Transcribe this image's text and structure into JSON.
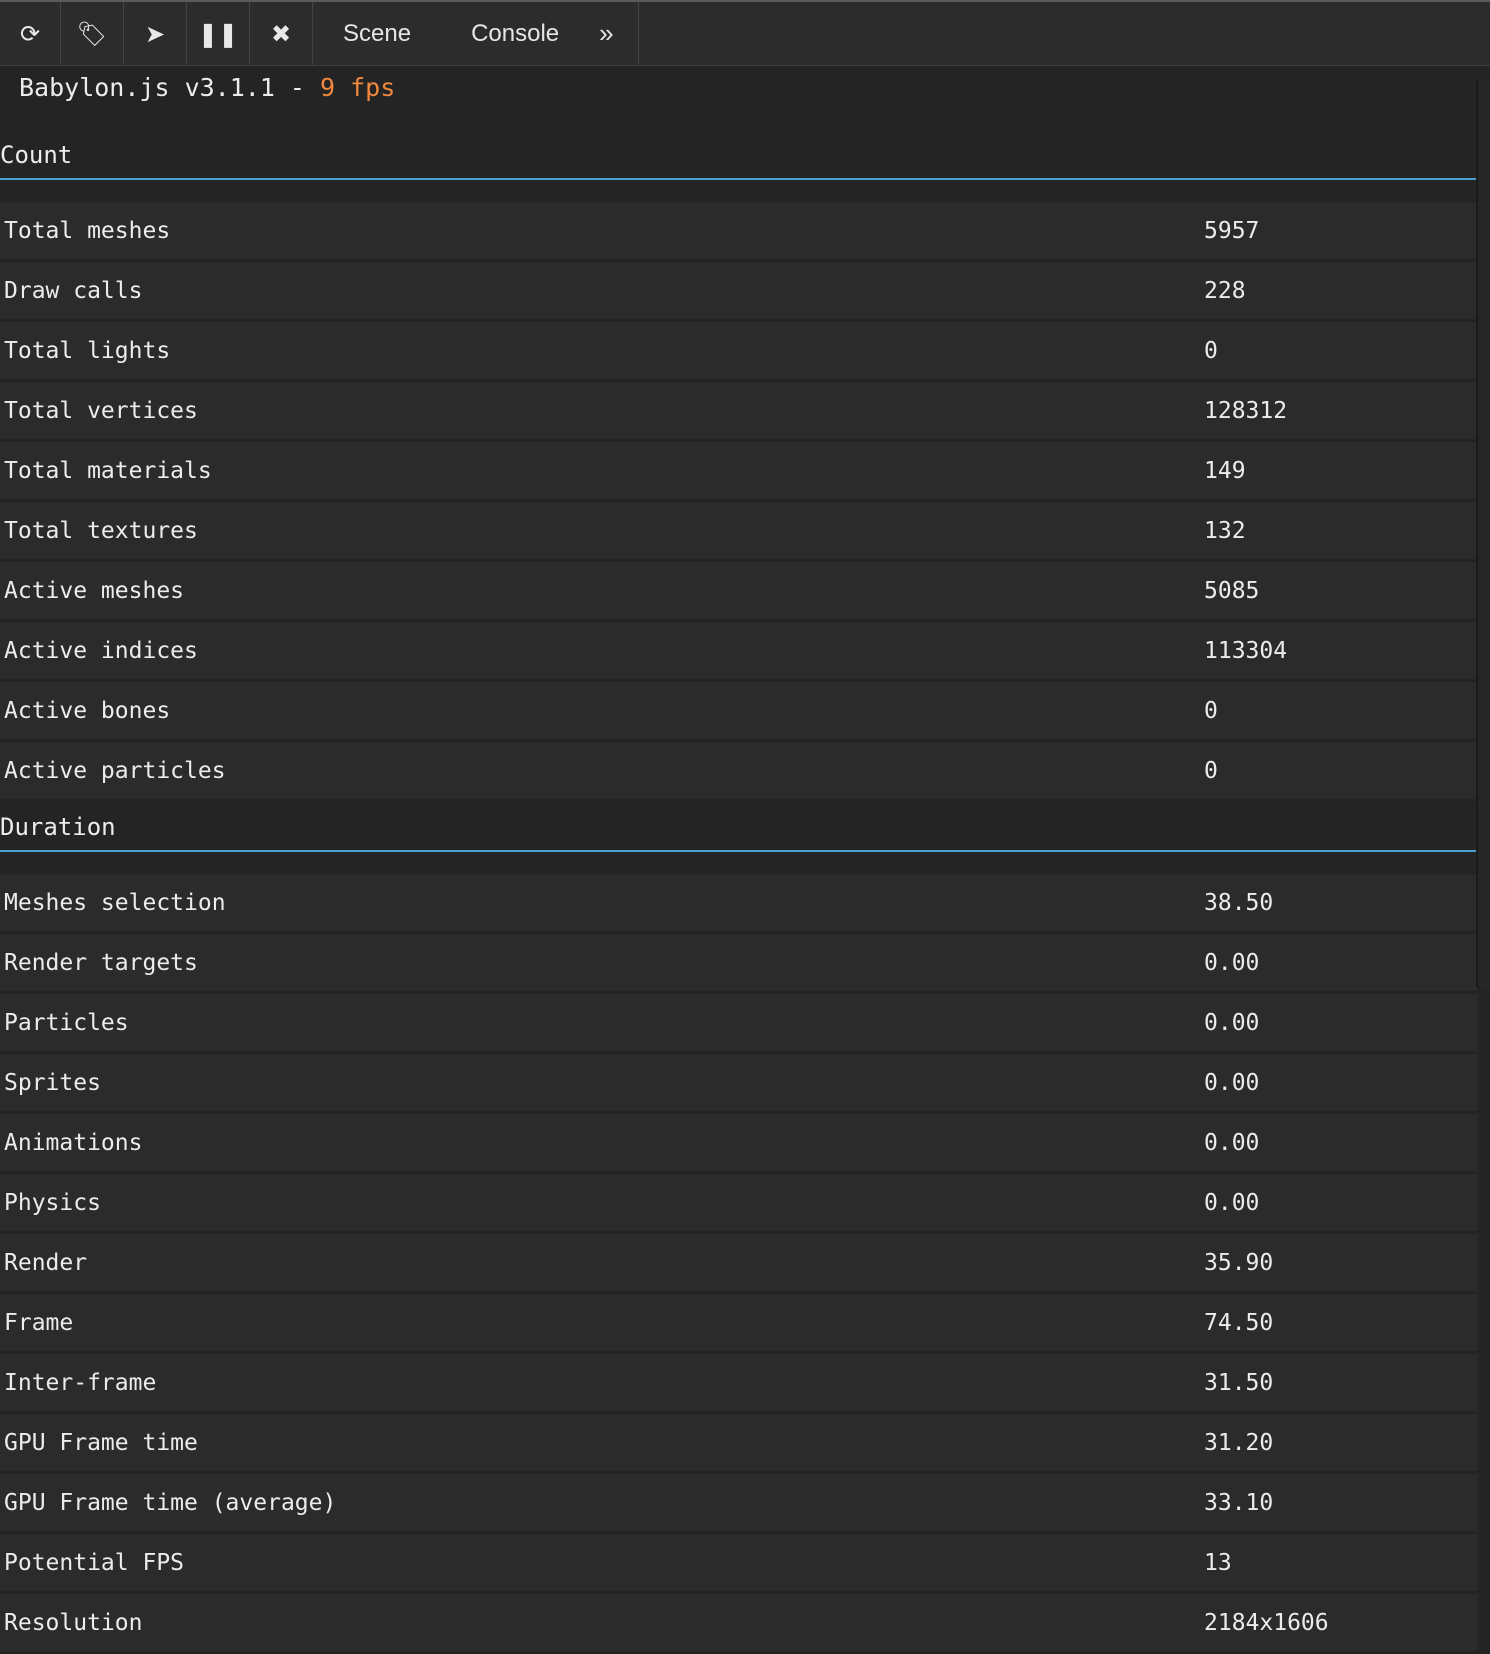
{
  "toolbar": {
    "buttons": [
      {
        "name": "refresh-icon",
        "glyph": "⟳"
      },
      {
        "name": "tags-icon",
        "glyph": "🏷"
      },
      {
        "name": "pointer-icon",
        "glyph": "➤"
      },
      {
        "name": "pause-icon",
        "glyph": "❚❚"
      },
      {
        "name": "close-icon",
        "glyph": "✖"
      }
    ],
    "tabs": [
      "Scene",
      "Console"
    ],
    "more_label": "»"
  },
  "header": {
    "engine": "Babylon.js v3.1.1 - ",
    "fps": "9 fps"
  },
  "sections": {
    "count": {
      "title": "Count",
      "rows": [
        {
          "label": "Total meshes",
          "value": "5957"
        },
        {
          "label": "Draw calls",
          "value": "228"
        },
        {
          "label": "Total lights",
          "value": "0"
        },
        {
          "label": "Total vertices",
          "value": "128312"
        },
        {
          "label": "Total materials",
          "value": "149"
        },
        {
          "label": "Total textures",
          "value": "132"
        },
        {
          "label": "Active meshes",
          "value": "5085"
        },
        {
          "label": "Active indices",
          "value": "113304"
        },
        {
          "label": "Active bones",
          "value": "0"
        },
        {
          "label": "Active particles",
          "value": "0"
        }
      ]
    },
    "duration": {
      "title": "Duration",
      "rows": [
        {
          "label": "Meshes selection",
          "value": "38.50"
        },
        {
          "label": "Render targets",
          "value": "0.00"
        },
        {
          "label": "Particles",
          "value": "0.00"
        },
        {
          "label": "Sprites",
          "value": "0.00"
        },
        {
          "label": "Animations",
          "value": "0.00"
        },
        {
          "label": "Physics",
          "value": "0.00"
        },
        {
          "label": "Render",
          "value": "35.90"
        },
        {
          "label": "Frame",
          "value": "74.50"
        },
        {
          "label": "Inter-frame",
          "value": "31.50"
        },
        {
          "label": "GPU Frame time",
          "value": "31.20"
        },
        {
          "label": "GPU Frame time (average)",
          "value": "33.10"
        },
        {
          "label": "Potential FPS",
          "value": "13"
        },
        {
          "label": "Resolution",
          "value": "2184x1606"
        }
      ]
    }
  },
  "colors": {
    "accent_fps": "#f0883e",
    "section_underline": "#4a9fd0",
    "background": "#242424",
    "row_background": "#2b2b2b"
  }
}
